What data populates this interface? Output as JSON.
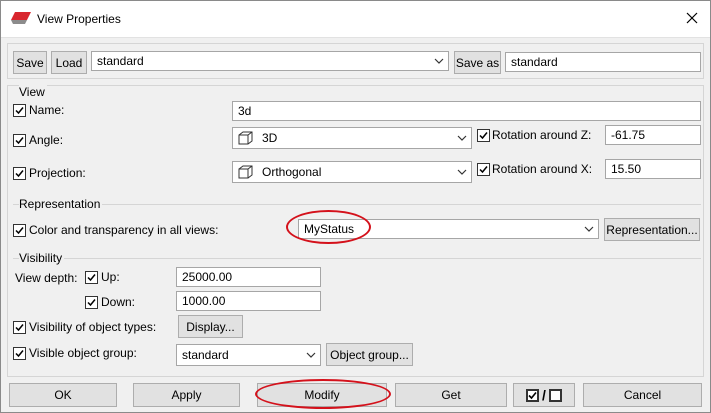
{
  "window": {
    "title": "View Properties"
  },
  "toolbar": {
    "save_label": "Save",
    "load_label": "Load",
    "preset_value": "standard",
    "save_as_label": "Save as",
    "save_as_value": "standard"
  },
  "view_group": {
    "heading": "View",
    "name_label": "Name:",
    "name_value": "3d",
    "angle_label": "Angle:",
    "angle_value": "3D",
    "rotation_z_label": "Rotation around Z:",
    "rotation_z_value": "-61.75",
    "projection_label": "Projection:",
    "projection_value": "Orthogonal",
    "rotation_x_label": "Rotation around X:",
    "rotation_x_value": "15.50"
  },
  "representation_group": {
    "heading": "Representation",
    "color_label": "Color and transparency in all views:",
    "color_value": "MyStatus",
    "representation_button": "Representation..."
  },
  "visibility_group": {
    "heading": "Visibility",
    "view_depth_label": "View depth:",
    "up_label": "Up:",
    "up_value": "25000.00",
    "down_label": "Down:",
    "down_value": "1000.00",
    "object_types_label": "Visibility of object types:",
    "display_button": "Display...",
    "object_group_label": "Visible object group:",
    "object_group_value": "standard",
    "object_group_button": "Object group..."
  },
  "footer": {
    "ok_label": "OK",
    "apply_label": "Apply",
    "modify_label": "Modify",
    "get_label": "Get",
    "toggle_separator": "/",
    "cancel_label": "Cancel"
  },
  "colors": {
    "annotation": "#d4111b",
    "app_icon": "#d8262e"
  }
}
